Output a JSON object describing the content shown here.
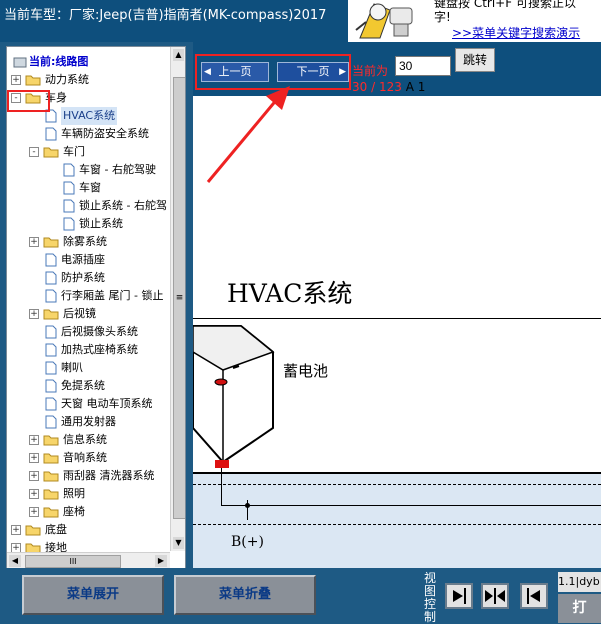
{
  "header": {
    "vehicle_title": "当前车型：厂家:Jeep(吉普)指南者(MK-compass)2017",
    "hint_line1": "键盘按 Ctrl+F 可搜索正以",
    "hint_line2": "字!",
    "hint_link": ">>菜单关键字搜索演示"
  },
  "tree": {
    "root": "当前:线路图",
    "items": [
      {
        "label": "动力系统",
        "type": "folder",
        "expander": "+"
      },
      {
        "label": "车身",
        "type": "folder",
        "expander": "-"
      },
      {
        "label": "HVAC系统",
        "type": "doc",
        "selected": true
      },
      {
        "label": "车辆防盗安全系统",
        "type": "doc"
      },
      {
        "label": "车门",
        "type": "folder",
        "expander": "-"
      },
      {
        "label": "车窗 - 右舵驾驶",
        "type": "doc"
      },
      {
        "label": "车窗",
        "type": "doc"
      },
      {
        "label": "锁止系统 - 右舵驾",
        "type": "doc"
      },
      {
        "label": "锁止系统",
        "type": "doc"
      },
      {
        "label": "除雾系统",
        "type": "folder",
        "expander": "+"
      },
      {
        "label": "电源插座",
        "type": "doc"
      },
      {
        "label": "防护系统",
        "type": "doc"
      },
      {
        "label": "行李厢盖 尾门 - 锁止",
        "type": "doc"
      },
      {
        "label": "后视镜",
        "type": "folder",
        "expander": "+"
      },
      {
        "label": "后视摄像头系统",
        "type": "doc"
      },
      {
        "label": "加热式座椅系统",
        "type": "doc"
      },
      {
        "label": "喇叭",
        "type": "doc"
      },
      {
        "label": "免提系统",
        "type": "doc"
      },
      {
        "label": "天窗 电动车顶系统",
        "type": "doc"
      },
      {
        "label": "通用发射器",
        "type": "doc"
      },
      {
        "label": "信息系统",
        "type": "folder",
        "expander": "+"
      },
      {
        "label": "音响系统",
        "type": "folder",
        "expander": "+"
      },
      {
        "label": "雨刮器 清洗器系统",
        "type": "folder",
        "expander": "+"
      },
      {
        "label": "照明",
        "type": "folder",
        "expander": "+"
      },
      {
        "label": "座椅",
        "type": "folder",
        "expander": "+"
      },
      {
        "label": "底盘",
        "type": "folder",
        "expander": "+"
      },
      {
        "label": "接地",
        "type": "folder",
        "expander": "+"
      }
    ],
    "vscroll_glyph": "≡",
    "hscroll_glyph": "III"
  },
  "nav": {
    "prev_label": "上一页",
    "next_label": "下一页",
    "current_label": "当前为",
    "page_value": "30",
    "jump_label": "跳转",
    "page_fraction": "30 / 123",
    "page_suffix": "A 1"
  },
  "document": {
    "heading": "HVAC系统",
    "battery_label": "蓄电池",
    "bus_label": "B(+)"
  },
  "bottom": {
    "expand_label": "菜单展开",
    "collapse_label": "菜单折叠",
    "view_control_label": "视图控制",
    "version_text": "1.1|dyb",
    "right_button_label": "打"
  },
  "colors": {
    "header_bg": "#0e4f7d",
    "bottom_bg": "#1e5a84",
    "highlight": "#ee2222",
    "page_red": "#ff2a2a",
    "button_text": "#0b3a86"
  }
}
